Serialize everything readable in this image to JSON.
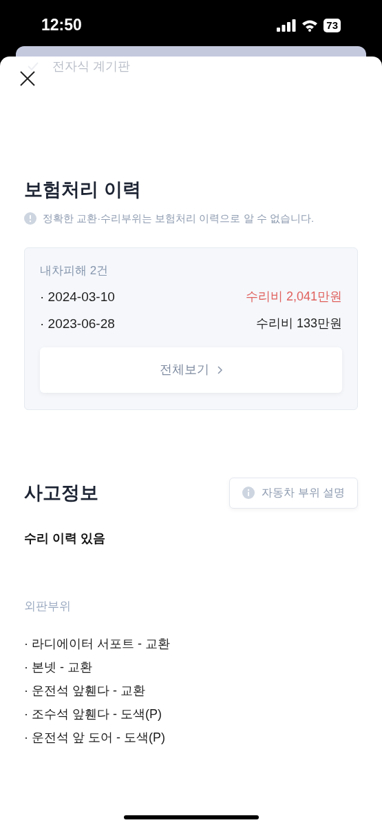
{
  "status_bar": {
    "time": "12:50",
    "battery": "73"
  },
  "background_sheet": {
    "item": "전자식 계기판"
  },
  "insurance": {
    "title": "보험처리 이력",
    "notice": "정확한 교환·수리부위는 보험처리 이력으로 알 수 없습니다.",
    "summary": "내차피해 2건",
    "claims": [
      {
        "date": "· 2024-03-10",
        "amount": "수리비 2,041만원",
        "highlighted": true
      },
      {
        "date": "· 2023-06-28",
        "amount": "수리비 133만원",
        "highlighted": false
      }
    ],
    "view_all": "전체보기"
  },
  "accident": {
    "title": "사고정보",
    "parts_button": "자동차 부위 설명",
    "status": "수리 이력 있음",
    "section": "외판부위",
    "parts": [
      "· 라디에이터 서포트 - 교환",
      "· 본넷 - 교환",
      "· 운전석 앞휀다 - 교환",
      "· 조수석 앞휀다 - 도색(P)",
      "· 운전석 앞 도어 - 도색(P)"
    ]
  }
}
